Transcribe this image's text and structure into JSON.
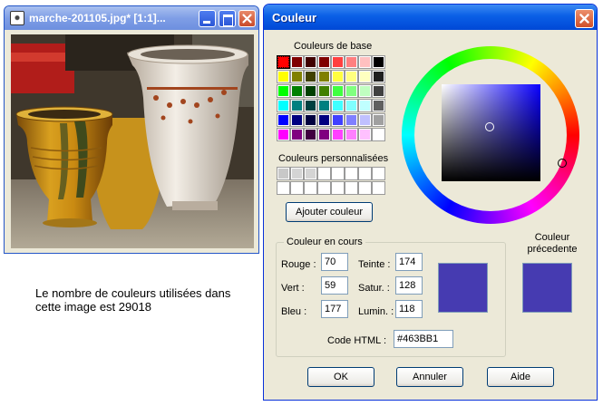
{
  "image_window": {
    "title": "marche-201105.jpg* [1:1]...",
    "photo_alt": "pottery vases",
    "caption": "Le nombre de couleurs utilisées dans cette image est 29018"
  },
  "dialog": {
    "title": "Couleur",
    "basic_label": "Couleurs de base",
    "custom_label": "Couleurs personnalisées",
    "add_button": "Ajouter couleur",
    "current_group": "Couleur en cours",
    "previous_label": "Couleur précedente",
    "fields": {
      "rouge_label": "Rouge :",
      "rouge": "70",
      "vert_label": "Vert :",
      "vert": "59",
      "bleu_label": "Bleu :",
      "bleu": "177",
      "teinte_label": "Teinte :",
      "teinte": "174",
      "satur_label": "Satur. :",
      "satur": "128",
      "lumin_label": "Lumin. :",
      "lumin": "118",
      "html_label": "Code HTML :",
      "html": "#463BB1"
    },
    "current_color": "#463bb1",
    "previous_color": "#463bb1",
    "buttons": {
      "ok": "OK",
      "cancel": "Annuler",
      "help": "Aide"
    },
    "basic_colors": [
      "#ff0000",
      "#800000",
      "#400000",
      "#800000",
      "#ff4040",
      "#ff8080",
      "#ffc0c0",
      "#000000",
      "#ffff00",
      "#808000",
      "#404000",
      "#808000",
      "#ffff40",
      "#ffff80",
      "#ffffc0",
      "#202020",
      "#00ff00",
      "#008000",
      "#004000",
      "#408000",
      "#40ff40",
      "#80ff80",
      "#c0ffc0",
      "#404040",
      "#00ffff",
      "#008080",
      "#004040",
      "#008080",
      "#40ffff",
      "#80ffff",
      "#c0ffff",
      "#606060",
      "#0000ff",
      "#000080",
      "#000040",
      "#000080",
      "#4040ff",
      "#8080ff",
      "#c0c0ff",
      "#a0a0a0",
      "#ff00ff",
      "#800080",
      "#400040",
      "#800080",
      "#ff40ff",
      "#ff80ff",
      "#ffc0ff",
      "#ffffff"
    ],
    "custom_colors": [
      "#c8c8c8",
      "#d4d4d4",
      "#d4d4d4",
      "#ffffff",
      "#ffffff",
      "#ffffff",
      "#ffffff",
      "#ffffff",
      "#ffffff",
      "#ffffff",
      "#ffffff",
      "#ffffff",
      "#ffffff",
      "#ffffff",
      "#ffffff",
      "#ffffff"
    ],
    "icons": {
      "close": "close-icon",
      "minimize": "minimize-icon",
      "maximize": "maximize-icon"
    }
  }
}
